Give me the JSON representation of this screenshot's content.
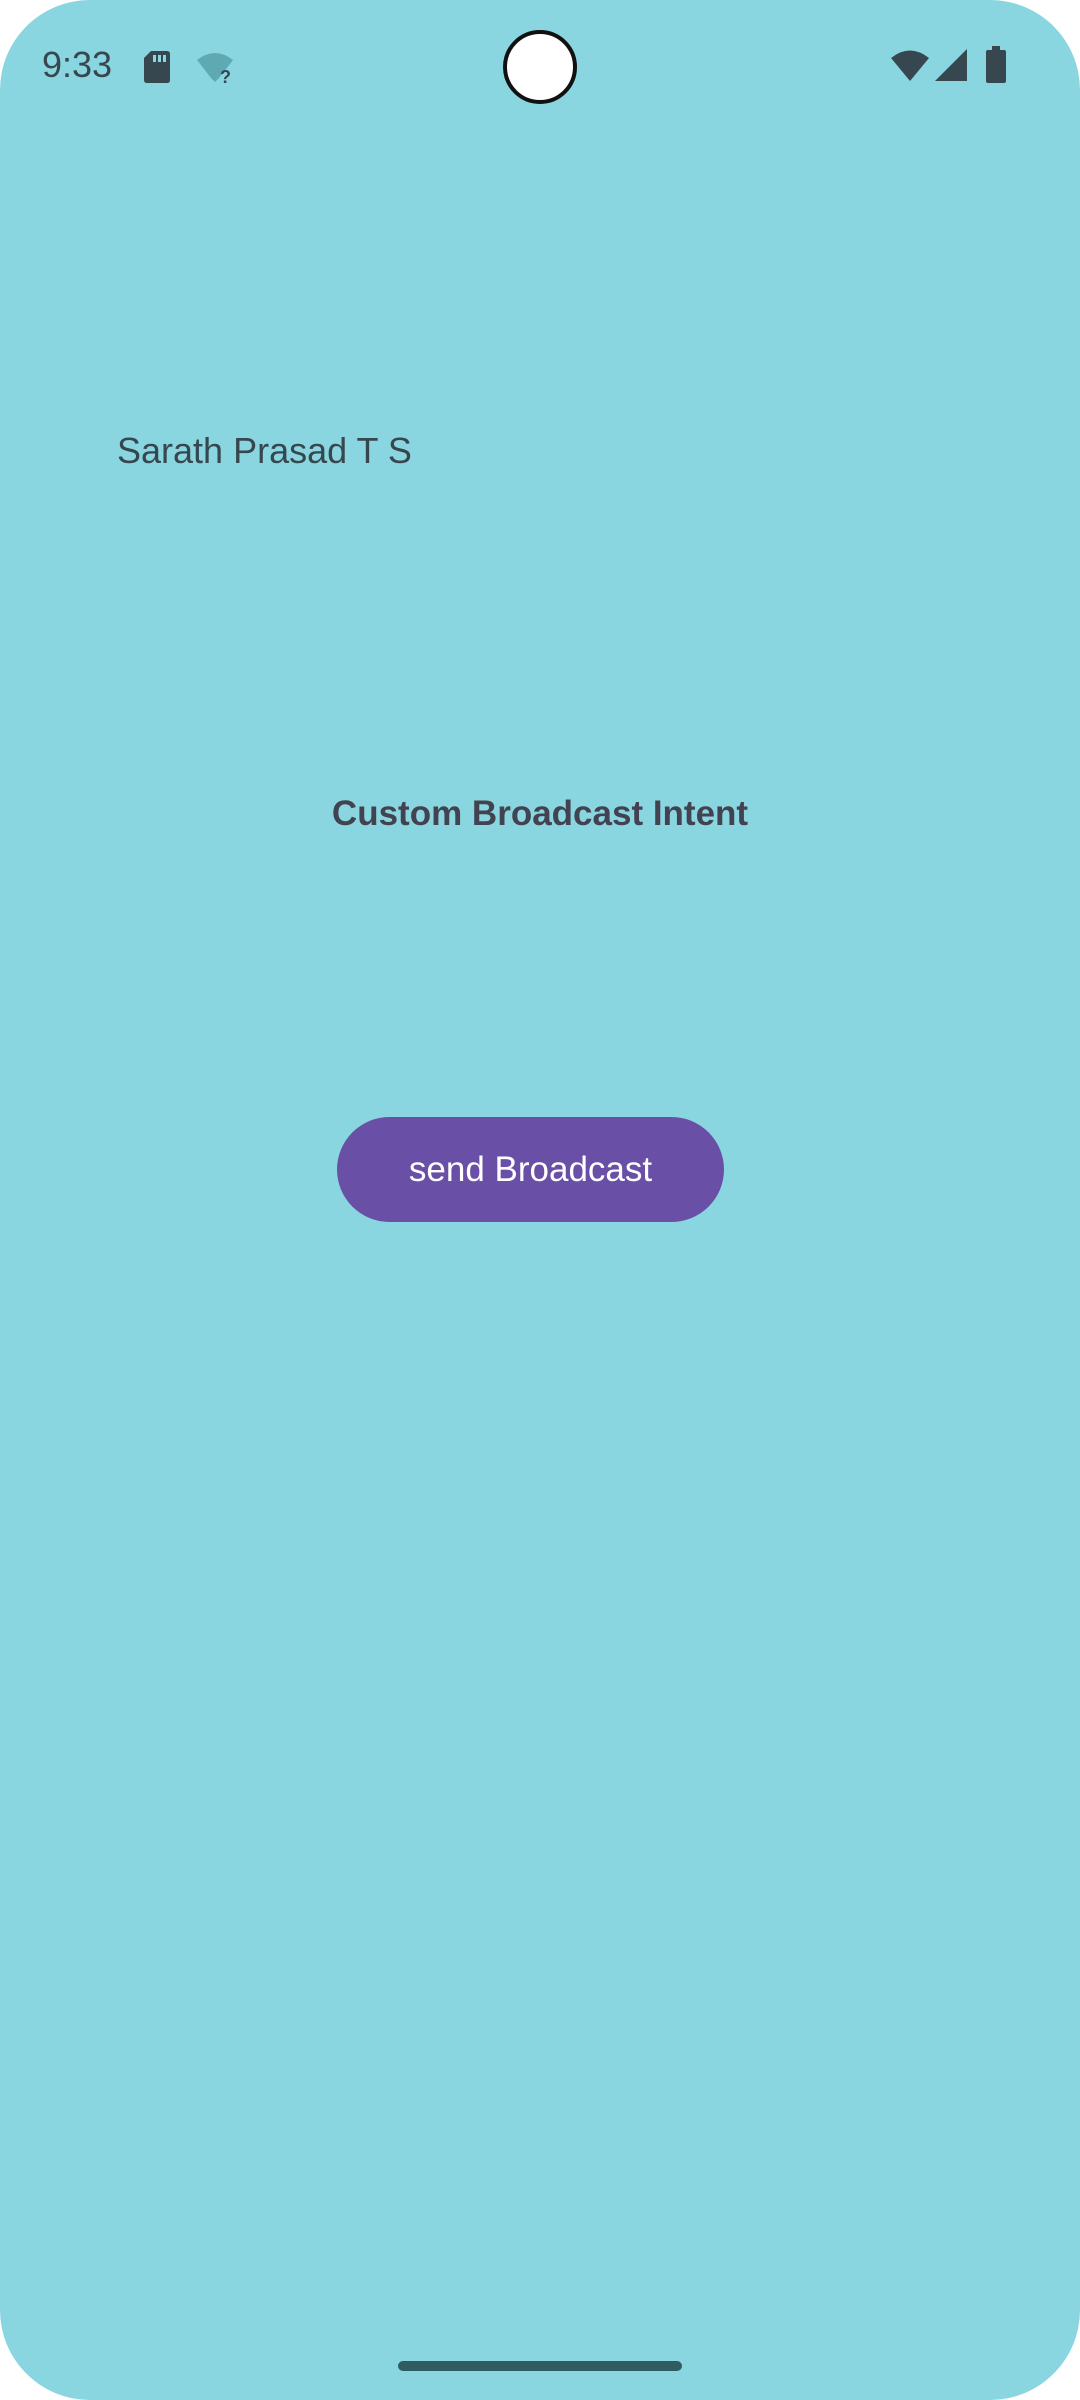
{
  "status_bar": {
    "time": "9:33",
    "icons": [
      "sd-card-icon",
      "wifi-unknown-icon",
      "wifi-icon",
      "cellular-signal-icon",
      "battery-icon"
    ]
  },
  "colors": {
    "background": "#89d6e0",
    "button": "#6950a6",
    "button_text": "#ffffff",
    "heading_text": "#424250",
    "body_text": "#37474f"
  },
  "main": {
    "author_name": "Sarath Prasad T S",
    "title": "Custom Broadcast Intent",
    "send_button_label": "send Broadcast"
  }
}
